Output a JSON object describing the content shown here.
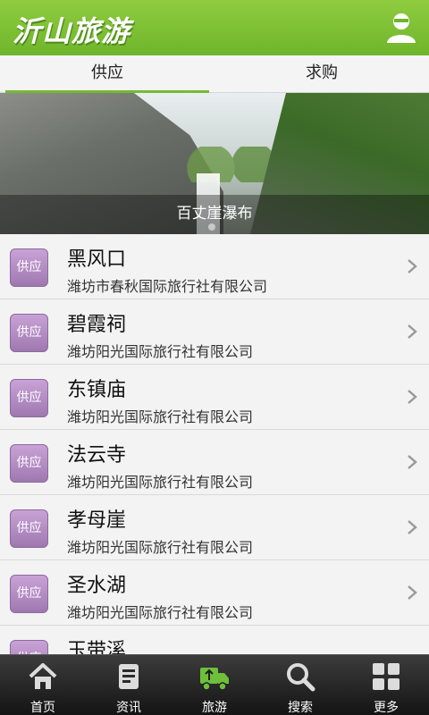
{
  "header": {
    "title": "沂山旅游",
    "user_icon": "user-icon"
  },
  "tabs": [
    {
      "label": "供应",
      "active": true
    },
    {
      "label": "求购",
      "active": false
    }
  ],
  "banner": {
    "caption": "百丈崖瀑布",
    "slide_index": 1,
    "slide_count": 1
  },
  "list": {
    "items": [
      {
        "badge": "供应",
        "title": "黑风口",
        "company": "潍坊市春秋国际旅行社有限公司"
      },
      {
        "badge": "供应",
        "title": "碧霞祠",
        "company": "潍坊阳光国际旅行社有限公司"
      },
      {
        "badge": "供应",
        "title": "东镇庙",
        "company": "潍坊阳光国际旅行社有限公司"
      },
      {
        "badge": "供应",
        "title": "法云寺",
        "company": "潍坊阳光国际旅行社有限公司"
      },
      {
        "badge": "供应",
        "title": "孝母崖",
        "company": "潍坊阳光国际旅行社有限公司"
      },
      {
        "badge": "供应",
        "title": "圣水湖",
        "company": "潍坊阳光国际旅行社有限公司"
      },
      {
        "badge": "供应",
        "title": "玉带溪",
        "company": ""
      }
    ]
  },
  "bottom_nav": [
    {
      "label": "首页",
      "icon": "home-icon",
      "active": false
    },
    {
      "label": "资讯",
      "icon": "news-icon",
      "active": false
    },
    {
      "label": "旅游",
      "icon": "travel-icon",
      "active": true
    },
    {
      "label": "搜索",
      "icon": "search-icon",
      "active": false
    },
    {
      "label": "更多",
      "icon": "more-icon",
      "active": false
    }
  ],
  "colors": {
    "header_green": "#76b936",
    "badge_purple": "#b08cc2",
    "nav_dark": "#262626",
    "active_icon_green": "#6fbf3a"
  }
}
